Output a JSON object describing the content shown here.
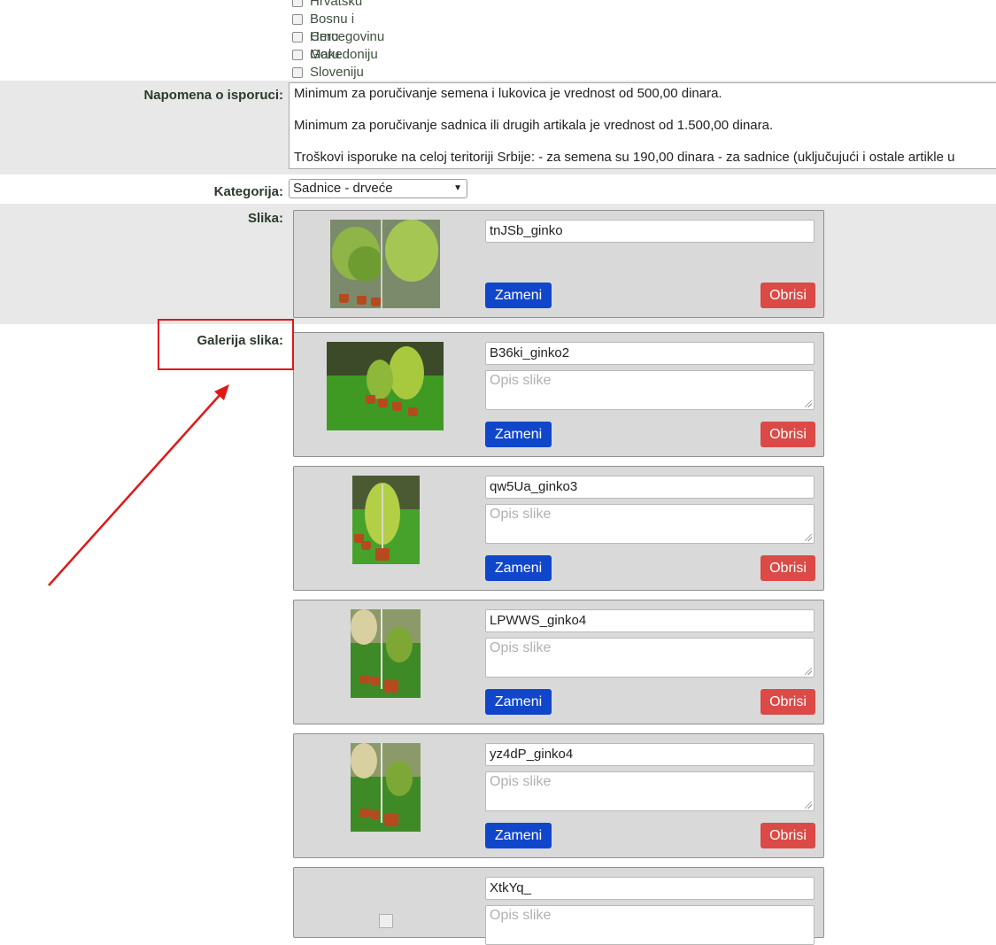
{
  "countries": [
    {
      "label": "Hrvatsku",
      "checked": false
    },
    {
      "label": "Bosnu i Hercegovinu",
      "checked": false
    },
    {
      "label": "Crnu Goru",
      "checked": false
    },
    {
      "label": "Makedoniju",
      "checked": false
    },
    {
      "label": "Sloveniju",
      "checked": false
    }
  ],
  "napomena": {
    "label": "Napomena o isporuci:",
    "lines": [
      "Minimum za poručivanje semena i lukovica je vrednost od 500,00 dinara.",
      "Minimum za poručivanje sadnica ili drugih artikala je vrednost od 1.500,00 dinara.",
      "Troškovi isporuke na celoj teritoriji Srbije: - za semena su 190,00 dinara - za sadnice (uključujući i ostale artikle u"
    ]
  },
  "kategorija": {
    "label": "Kategorija:",
    "selected": "Sadnice - drveće"
  },
  "slika": {
    "label": "Slika:",
    "image_name": "tnJSb_ginko",
    "replace_label": "Zameni",
    "delete_label": "Obrisi"
  },
  "galerija": {
    "label": "Galerija slika:",
    "desc_placeholder": "Opis slike",
    "replace_label": "Zameni",
    "delete_label": "Obrisi",
    "items": [
      {
        "image_name": "B36ki_ginko2"
      },
      {
        "image_name": "qw5Ua_ginko3"
      },
      {
        "image_name": "LPWWS_ginko4"
      },
      {
        "image_name": "yz4dP_ginko4"
      },
      {
        "image_name": "XtkYq_"
      }
    ]
  },
  "colors": {
    "zameni_button": "#1046c9",
    "obrisi_button": "#db4a46",
    "annotation": "#e01818",
    "row_gray": "#e8e8e8"
  }
}
